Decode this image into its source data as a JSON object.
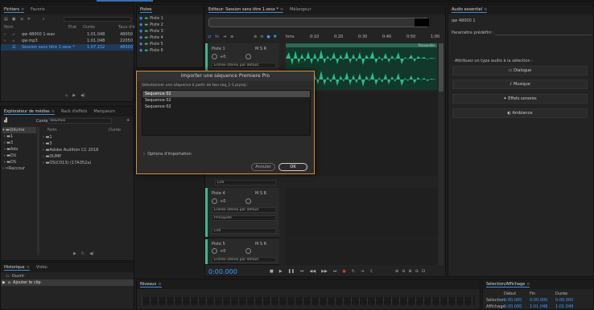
{
  "files_panel": {
    "tabs": [
      "Fichiers",
      "Favoris"
    ],
    "columns": [
      "Nom",
      "Etat",
      "Durée",
      "Taux d'é"
    ],
    "rows": [
      {
        "name": "qw 48000 1.wav",
        "duration": "1:01.048",
        "rate": "48000"
      },
      {
        "name": "qw.mp3",
        "duration": "1:01.048",
        "rate": "22050"
      },
      {
        "name": "Session sans titre 1.sesx *",
        "duration": "1:07.152",
        "rate": "48000"
      }
    ]
  },
  "media_panel": {
    "tabs": [
      "Explorateur de médias",
      "Rack d'effets",
      "Marqueurs"
    ],
    "contents_label": "Contenu :",
    "contents_value": "Volumes",
    "columns": [
      "Nom",
      "Durée"
    ],
    "tree": [
      "Volume",
      "1",
      "3",
      "Ado",
      "DU",
      "OS",
      "Raccour"
    ],
    "list": [
      "1",
      "3",
      "Adobe Audition CC 2018",
      "DUMP",
      "OS(C013) (17A352a)"
    ]
  },
  "history_panel": {
    "tabs": [
      "Historique",
      "Vidéo"
    ],
    "items": [
      "Ouvrir",
      "Ajouter le clip"
    ]
  },
  "tracks_panel": {
    "title": "Pistes",
    "items": [
      "Piste 1",
      "Piste 2",
      "Piste 3",
      "Piste 4",
      "Piste 5",
      "Piste 6"
    ]
  },
  "editor": {
    "tabs": [
      "Editeur: Session sans titre 1.sesx *",
      "Mélangeur"
    ],
    "ruler": [
      "hms",
      "0:10",
      "0:20",
      "0:30",
      "0:40",
      "0:50",
      "1:00"
    ],
    "tracks": [
      {
        "name": "Piste 1",
        "volume": "+0",
        "input": "Entrée stéréo par défaut",
        "mode": "Lire"
      },
      {
        "name": "Piste 4",
        "volume": "+0",
        "input": "Entrée stéréo par défaut",
        "output": "Principale",
        "mode": "Lire"
      },
      {
        "name": "Piste 5",
        "volume": "+0",
        "input": "Entrée stéréo par défaut"
      }
    ],
    "clip_label": "Passerelle",
    "timecode": "0:00.000"
  },
  "dialog": {
    "title": "Importer une séquence Premiere Pro",
    "label": "Sélectionner une séquence à partir de two seq_1-1.prproj :",
    "sequences": [
      "Sequence 02",
      "Sequence 02",
      "Sequence 02"
    ],
    "options": "Options d'importation",
    "cancel": "Annuler",
    "ok": "OK"
  },
  "essential_sound": {
    "title": "Audio essentiel",
    "file": "qw 48000 1",
    "preset_label": "Paramètre prédéfini :",
    "assign_label": "Attribuez un type audio à la sélection :",
    "buttons": [
      "Dialogue",
      "Musique",
      "Effets sonores",
      "Ambiance"
    ]
  },
  "levels": {
    "title": "Niveaux"
  },
  "selection_panel": {
    "title": "Sélection/Affichage",
    "columns": [
      "Début",
      "Fin",
      "Durée"
    ],
    "rows": [
      {
        "label": "Sélection",
        "start": "0:00.000",
        "end": "0:00.000",
        "duration": "0:00.000"
      },
      {
        "label": "Affichage",
        "start": "0:00.000",
        "end": "1:01.048",
        "duration": "1:01.048"
      }
    ]
  },
  "colors": {
    "accent": "#3a9bff",
    "waveform": "#2ed69a",
    "dialog_border": "#e08a2a",
    "record": "#e03030"
  }
}
